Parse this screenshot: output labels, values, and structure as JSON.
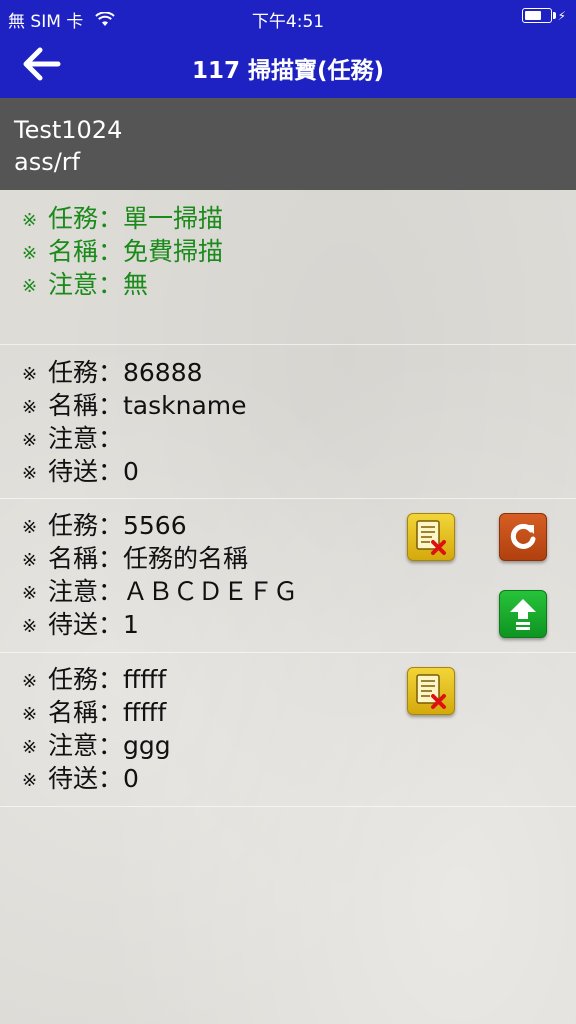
{
  "status_bar": {
    "carrier": "無 SIM 卡",
    "time": "下午4:51"
  },
  "nav": {
    "title": "117 掃描寶(任務)",
    "back_icon": "back-arrow-icon"
  },
  "account": {
    "name": "Test1024",
    "path": "ass/rf"
  },
  "summary": {
    "mark": "※",
    "task": "任務：單一掃描",
    "name": "名稱：免費掃描",
    "note": "注意：無"
  },
  "tasks": [
    {
      "task": "任務：86888",
      "name": "名稱：taskname",
      "note": "注意：",
      "pending": "待送：0"
    },
    {
      "task": "任務：5566",
      "name": "名稱：任務的名稱",
      "note": "注意：ＡＢＣＤＥＦＧ",
      "pending": "待送：1"
    },
    {
      "task": "任務：fffff",
      "name": "名稱：fffff",
      "note": "注意：ggg",
      "pending": "待送：0"
    }
  ],
  "colors": {
    "header": "#1f22c2",
    "account_bar": "#555555",
    "summary_text": "#1a8a1a"
  }
}
